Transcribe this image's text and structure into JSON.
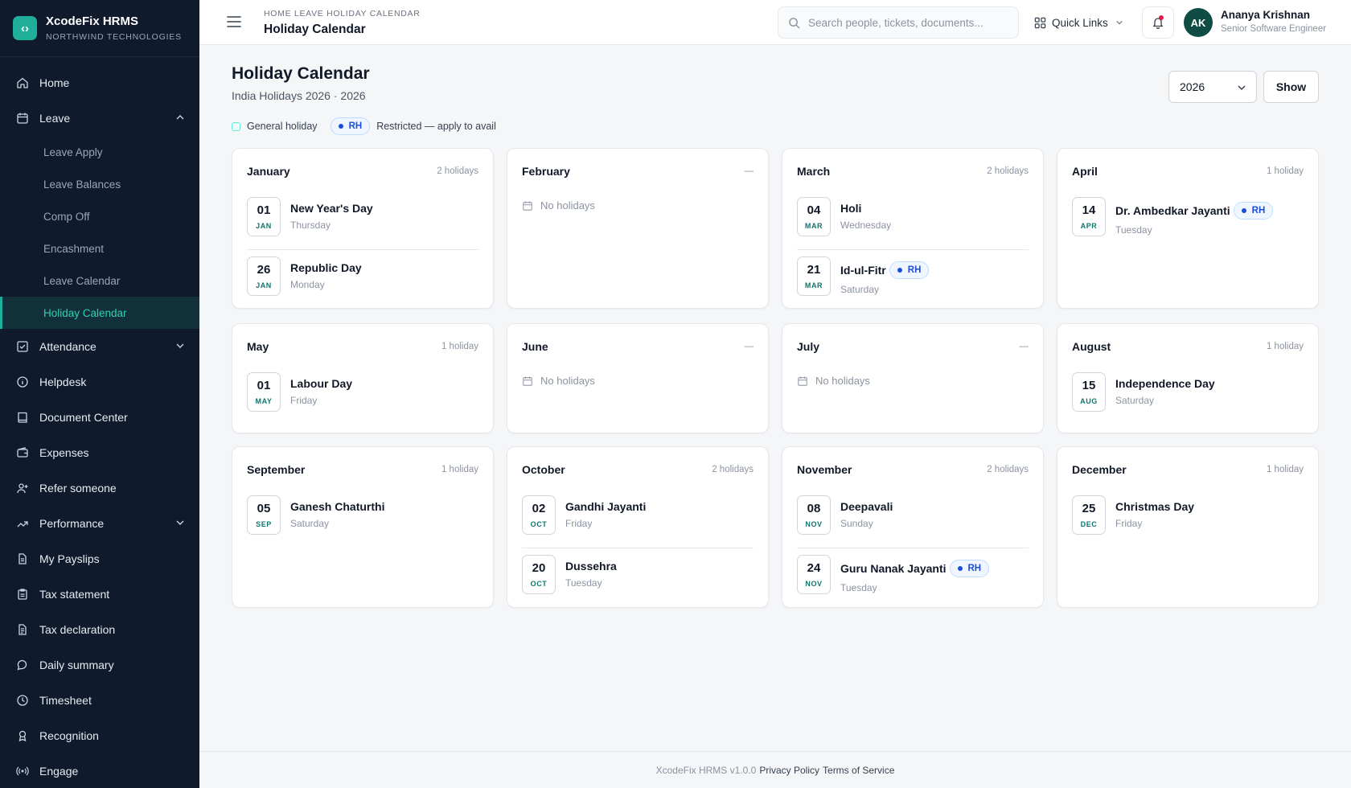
{
  "brand": {
    "name": "XcodeFix HRMS",
    "company": "NORTHWIND TECHNOLOGIES",
    "logo_icon": "code-brackets-icon"
  },
  "sidebar": {
    "items": [
      {
        "label": "Home",
        "icon": "home-icon"
      },
      {
        "label": "Leave",
        "icon": "calendar-icon",
        "expanded": true,
        "children": [
          "Leave Apply",
          "Leave Balances",
          "Comp Off",
          "Encashment",
          "Leave Calendar",
          "Holiday Calendar"
        ],
        "active_child": "Holiday Calendar"
      },
      {
        "label": "Attendance",
        "icon": "check-square-icon",
        "expandable": true
      },
      {
        "label": "Helpdesk",
        "icon": "info-icon"
      },
      {
        "label": "Document Center",
        "icon": "book-icon"
      },
      {
        "label": "Expenses",
        "icon": "wallet-icon"
      },
      {
        "label": "Refer someone",
        "icon": "user-plus-icon"
      },
      {
        "label": "Performance",
        "icon": "trending-up-icon",
        "expandable": true
      },
      {
        "label": "My Payslips",
        "icon": "file-icon"
      },
      {
        "label": "Tax statement",
        "icon": "clipboard-icon"
      },
      {
        "label": "Tax declaration",
        "icon": "file-text-icon"
      },
      {
        "label": "Daily summary",
        "icon": "chat-icon"
      },
      {
        "label": "Timesheet",
        "icon": "clock-icon"
      },
      {
        "label": "Recognition",
        "icon": "award-icon"
      },
      {
        "label": "Engage",
        "icon": "broadcast-icon"
      }
    ]
  },
  "topbar": {
    "breadcrumb": "HOME LEAVE HOLIDAY CALENDAR",
    "title": "Holiday Calendar",
    "search_placeholder": "Search people, tickets, documents...",
    "quick_links": "Quick Links",
    "user": {
      "initials": "AK",
      "name": "Ananya Krishnan",
      "role": "Senior Software Engineer"
    }
  },
  "page": {
    "title": "Holiday Calendar",
    "subtitle": "India Holidays 2026 · 2026",
    "year": "2026",
    "show_label": "Show",
    "legend": {
      "general": "General holiday",
      "rh": "RH",
      "restricted": "Restricted — apply to avail"
    }
  },
  "months": [
    {
      "name": "January",
      "count": "2 holidays",
      "holidays": [
        {
          "day": "01",
          "mon": "JAN",
          "name": "New Year's Day",
          "weekday": "Thursday",
          "rh": false
        },
        {
          "day": "26",
          "mon": "JAN",
          "name": "Republic Day",
          "weekday": "Monday",
          "rh": false
        }
      ]
    },
    {
      "name": "February",
      "count": "—",
      "holidays": []
    },
    {
      "name": "March",
      "count": "2 holidays",
      "holidays": [
        {
          "day": "04",
          "mon": "MAR",
          "name": "Holi",
          "weekday": "Wednesday",
          "rh": false
        },
        {
          "day": "21",
          "mon": "MAR",
          "name": "Id-ul-Fitr",
          "weekday": "Saturday",
          "rh": true
        }
      ]
    },
    {
      "name": "April",
      "count": "1 holiday",
      "holidays": [
        {
          "day": "14",
          "mon": "APR",
          "name": "Dr. Ambedkar Jayanti",
          "weekday": "Tuesday",
          "rh": true
        }
      ]
    },
    {
      "name": "May",
      "count": "1 holiday",
      "holidays": [
        {
          "day": "01",
          "mon": "MAY",
          "name": "Labour Day",
          "weekday": "Friday",
          "rh": false
        }
      ]
    },
    {
      "name": "June",
      "count": "—",
      "holidays": []
    },
    {
      "name": "July",
      "count": "—",
      "holidays": []
    },
    {
      "name": "August",
      "count": "1 holiday",
      "holidays": [
        {
          "day": "15",
          "mon": "AUG",
          "name": "Independence Day",
          "weekday": "Saturday",
          "rh": false
        }
      ]
    },
    {
      "name": "September",
      "count": "1 holiday",
      "holidays": [
        {
          "day": "05",
          "mon": "SEP",
          "name": "Ganesh Chaturthi",
          "weekday": "Saturday",
          "rh": false
        }
      ]
    },
    {
      "name": "October",
      "count": "2 holidays",
      "holidays": [
        {
          "day": "02",
          "mon": "OCT",
          "name": "Gandhi Jayanti",
          "weekday": "Friday",
          "rh": false
        },
        {
          "day": "20",
          "mon": "OCT",
          "name": "Dussehra",
          "weekday": "Tuesday",
          "rh": false
        }
      ]
    },
    {
      "name": "November",
      "count": "2 holidays",
      "holidays": [
        {
          "day": "08",
          "mon": "NOV",
          "name": "Deepavali",
          "weekday": "Sunday",
          "rh": false
        },
        {
          "day": "24",
          "mon": "NOV",
          "name": "Guru Nanak Jayanti",
          "weekday": "Tuesday",
          "rh": true
        }
      ]
    },
    {
      "name": "December",
      "count": "1 holiday",
      "holidays": [
        {
          "day": "25",
          "mon": "DEC",
          "name": "Christmas Day",
          "weekday": "Friday",
          "rh": false
        }
      ]
    }
  ],
  "empty_label": "No holidays",
  "footer": {
    "version": "XcodeFix HRMS v1.0.0",
    "privacy": "Privacy Policy",
    "terms": "Terms of Service"
  },
  "colors": {
    "sidebar_bg": "#0f1b2d",
    "accent": "#1fae9a",
    "rh_blue": "#1d4ed8"
  }
}
